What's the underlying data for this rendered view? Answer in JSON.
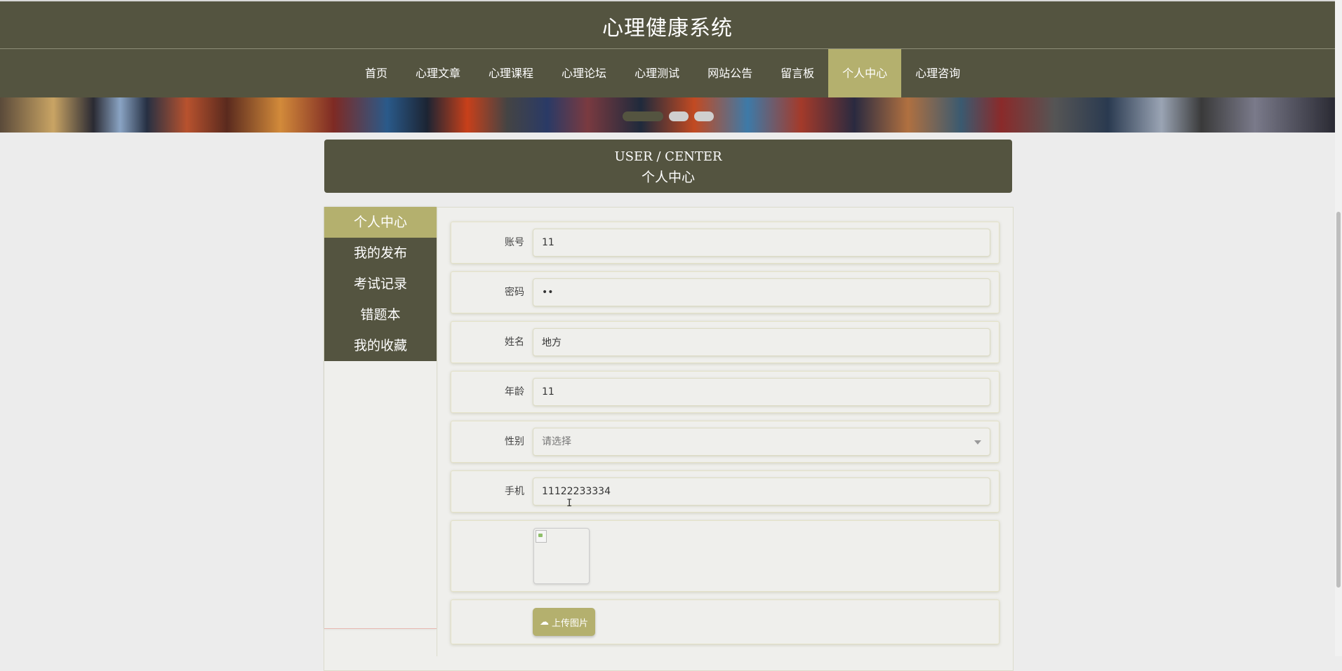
{
  "header": {
    "title": "心理健康系统"
  },
  "nav": {
    "items": [
      {
        "label": "首页"
      },
      {
        "label": "心理文章"
      },
      {
        "label": "心理课程"
      },
      {
        "label": "心理论坛"
      },
      {
        "label": "心理测试"
      },
      {
        "label": "网站公告"
      },
      {
        "label": "留言板"
      },
      {
        "label": "个人中心",
        "active": true
      },
      {
        "label": "心理咨询"
      }
    ]
  },
  "banner": {
    "dot_count": 3,
    "active_dot": 0
  },
  "center_header": {
    "en": "USER / CENTER",
    "cn": "个人中心"
  },
  "sidebar": {
    "items": [
      {
        "label": "个人中心",
        "active": true
      },
      {
        "label": "我的发布"
      },
      {
        "label": "考试记录"
      },
      {
        "label": "错题本"
      },
      {
        "label": "我的收藏"
      }
    ]
  },
  "form": {
    "account": {
      "label": "账号",
      "value": "11"
    },
    "password": {
      "label": "密码",
      "value": "••"
    },
    "name": {
      "label": "姓名",
      "value": "地方"
    },
    "age": {
      "label": "年龄",
      "value": "11"
    },
    "gender": {
      "label": "性别",
      "value": "请选择"
    },
    "phone": {
      "label": "手机",
      "value": "11122233334"
    },
    "upload_label": "上传图片"
  },
  "colors": {
    "primary": "#545440",
    "accent": "#b4b06e",
    "background": "#ececec"
  },
  "icons": {
    "upload": "cloud-upload-icon",
    "select": "chevron-down-icon",
    "image": "broken-image-icon"
  }
}
